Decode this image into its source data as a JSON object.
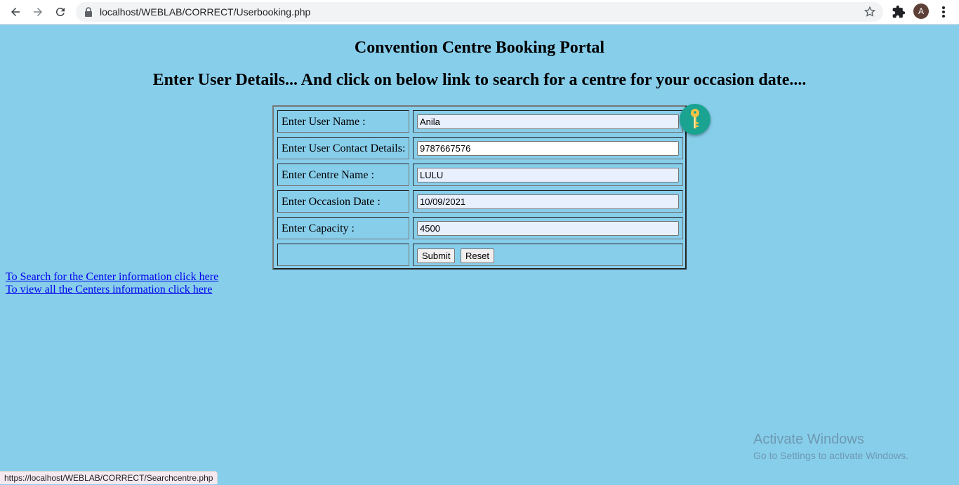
{
  "browser": {
    "url": "localhost/WEBLAB/CORRECT/Userbooking.php",
    "avatar_letter": "A",
    "status_url": "https://localhost/WEBLAB/CORRECT/Searchcentre.php"
  },
  "page": {
    "title": "Convention Centre Booking Portal",
    "subtitle": "Enter User Details... And click on below link to search for a centre for your occasion date....",
    "background_color": "#87ceeb"
  },
  "form": {
    "fields": [
      {
        "label": "Enter User Name :",
        "value": "Anila"
      },
      {
        "label": "Enter User Contact Details:",
        "value": "9787667576"
      },
      {
        "label": "Enter Centre Name :",
        "value": "LULU"
      },
      {
        "label": "Enter Occasion Date :",
        "value": "10/09/2021"
      },
      {
        "label": "Enter Capacity :",
        "value": "4500"
      }
    ],
    "submit_label": "Submit",
    "reset_label": "Reset",
    "badge_icon": "key-icon",
    "badge_color": "#1aa391"
  },
  "links": {
    "search_center": "To Search for the Center information click here",
    "view_all": "To view all the Centers information click here",
    "color": "#0000ee"
  },
  "watermark": {
    "line1": "Activate Windows",
    "line2": "Go to Settings to activate Windows."
  }
}
